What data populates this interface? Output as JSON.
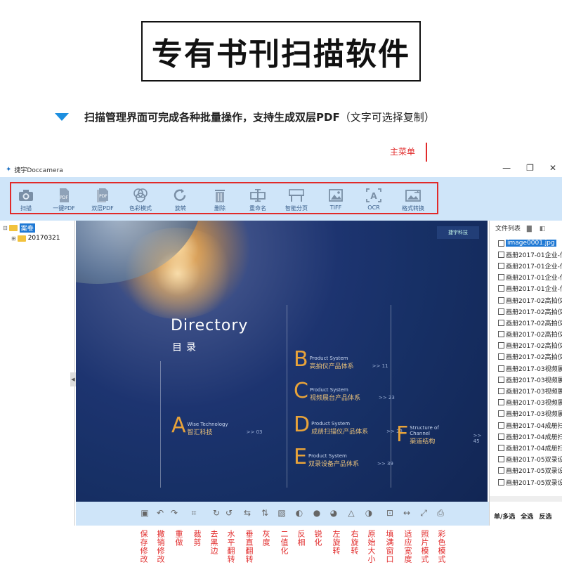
{
  "header": {
    "title": "专有书刊扫描软件",
    "subtitle_main": "扫描管理界面可完成各种批量操作，支持生成双层PDF",
    "subtitle_paren": "（文字可选择复制）",
    "menu_callout": "主菜单"
  },
  "window": {
    "title": "捷宇Doccamera",
    "minimize": "—",
    "restore": "❐",
    "close": "✕"
  },
  "toolbar": {
    "items": [
      {
        "label": "扫描",
        "icon": "camera-icon"
      },
      {
        "label": "一键PDF",
        "icon": "pdf-icon"
      },
      {
        "label": "双层PDF",
        "icon": "double-pdf-icon"
      },
      {
        "label": "色彩模式",
        "icon": "color-mode-icon"
      },
      {
        "label": "旋转",
        "icon": "rotate-icon"
      },
      {
        "label": "删除",
        "icon": "trash-icon"
      },
      {
        "label": "重命名",
        "icon": "rename-icon"
      },
      {
        "label": "智能分页",
        "icon": "split-page-icon"
      },
      {
        "label": "TIFF",
        "icon": "tiff-icon"
      },
      {
        "label": "OCR",
        "icon": "ocr-icon"
      },
      {
        "label": "格式转换",
        "icon": "format-convert-icon"
      }
    ]
  },
  "tree": {
    "root": "案卷",
    "child": "20170321"
  },
  "preview": {
    "directory_en": "Directory",
    "directory_cn": "目录",
    "brand": "捷宇科技",
    "entries": [
      {
        "letter": "A",
        "en": "Wise Technology",
        "cn": "智汇科技",
        "page": ">> 03"
      },
      {
        "letter": "B",
        "en": "Product System",
        "cn": "高拍仪产品体系",
        "page": ">> 11"
      },
      {
        "letter": "C",
        "en": "Product System",
        "cn": "视频展台产品体系",
        "page": ">> 23"
      },
      {
        "letter": "D",
        "en": "Product System",
        "cn": "成册扫描仪产品体系",
        "page": ">> 33"
      },
      {
        "letter": "E",
        "en": "Product System",
        "cn": "双录设备产品体系",
        "page": ">> 39"
      },
      {
        "letter": "F",
        "en": "Structure of Channel",
        "cn": "渠道结构",
        "page": ">> 45"
      }
    ]
  },
  "file_list": {
    "header": "文件列表",
    "files": [
      "image0001.jpg",
      "画册2017-01企业-信",
      "画册2017-01企业-信",
      "画册2017-01企业-信",
      "画册2017-01企业-信",
      "画册2017-02高拍仪",
      "画册2017-02高拍仪",
      "画册2017-02高拍仪",
      "画册2017-02高拍仪",
      "画册2017-02高拍仪",
      "画册2017-02高拍仪",
      "画册2017-03视频展",
      "画册2017-03视频展",
      "画册2017-03视频展",
      "画册2017-03视频展",
      "画册2017-03视频展",
      "画册2017-04成册扫",
      "画册2017-04成册扫",
      "画册2017-04成册扫",
      "画册2017-05双录设",
      "画册2017-05双录设",
      "画册2017-05双录设"
    ],
    "footer": [
      "单/多选",
      "全选",
      "反选"
    ]
  },
  "bottom_labels": [
    "保存修改",
    "撤销修改",
    "重做",
    "裁剪",
    "去黑边",
    "水平翻转",
    "垂直翻转",
    "灰度",
    "二值化",
    "反相",
    "锐化",
    "左旋转",
    "右旋转",
    "原始大小",
    "填满窗口",
    "适应宽度",
    "照片模式",
    "彩色模式"
  ],
  "colors": {
    "accent": "#1d8fe0",
    "callout": "#e12a2a",
    "toolbar_bg": "#cfe5f9"
  }
}
